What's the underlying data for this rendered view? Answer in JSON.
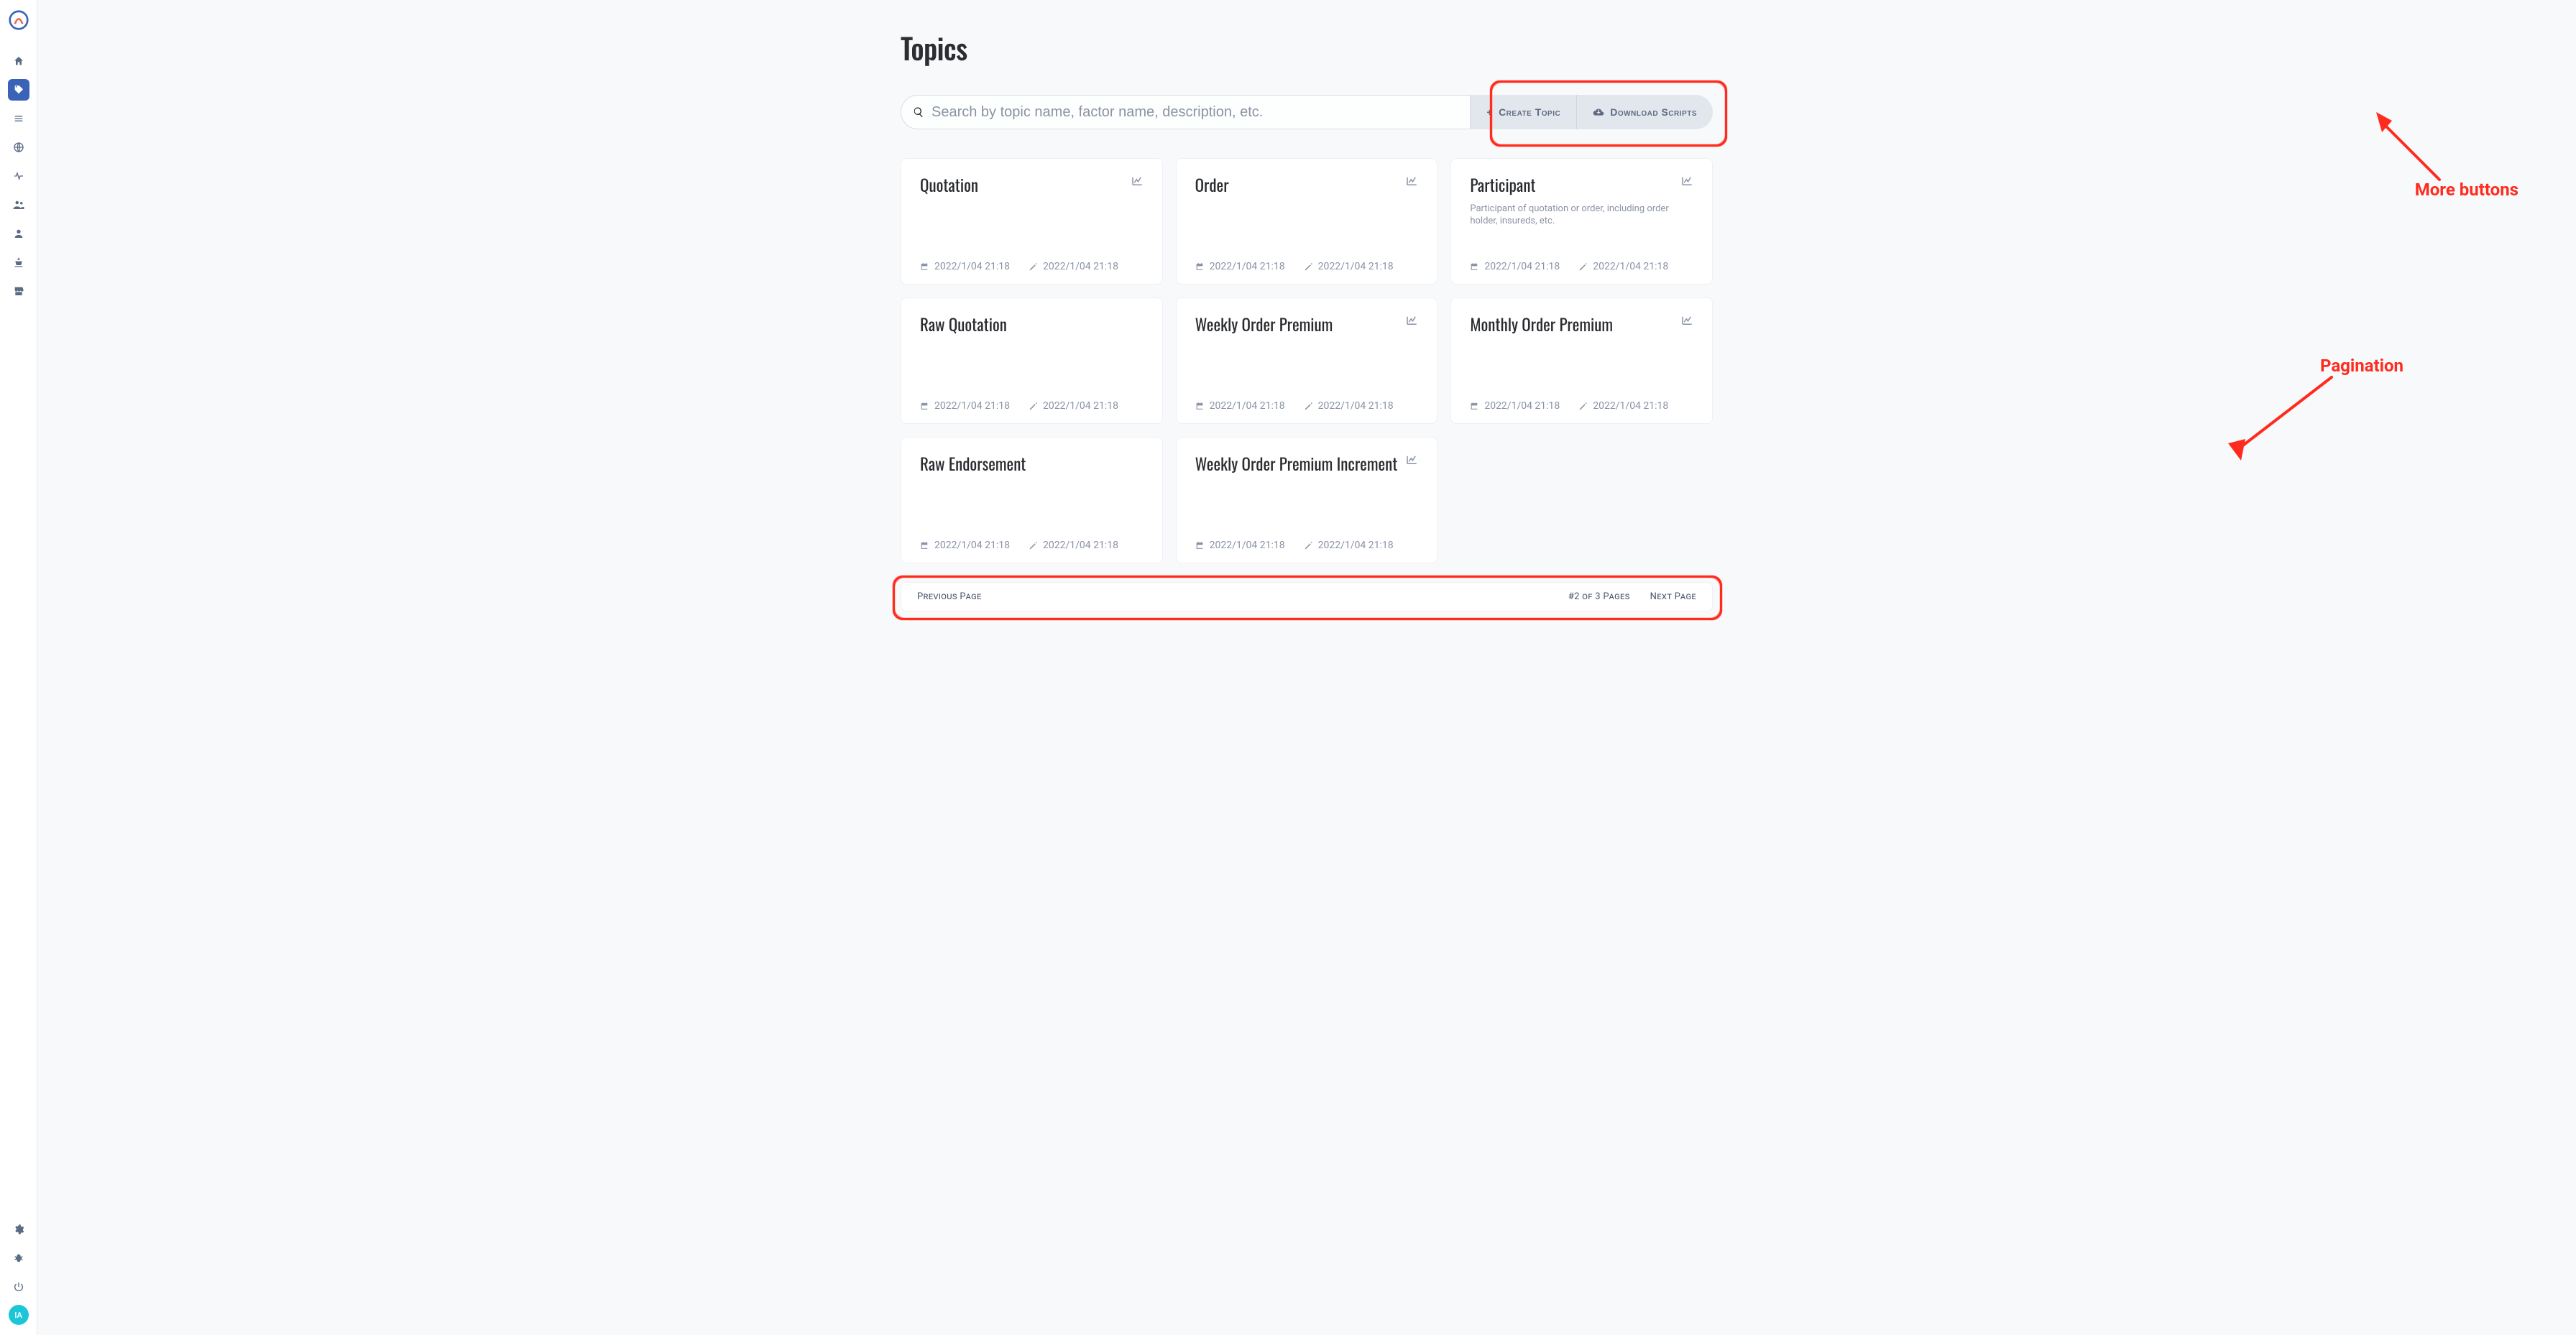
{
  "sidebar": {
    "avatar_initials": "IA"
  },
  "page": {
    "title": "Topics"
  },
  "toolbar": {
    "search_placeholder": "Search by topic name, factor name, description, etc.",
    "create_label": "Create Topic",
    "download_label": "Download Scripts"
  },
  "cards": [
    {
      "title": "Quotation",
      "desc": "",
      "hasChart": true,
      "created": "2022/1/04 21:18",
      "modified": "2022/1/04 21:18"
    },
    {
      "title": "Order",
      "desc": "",
      "hasChart": true,
      "created": "2022/1/04 21:18",
      "modified": "2022/1/04 21:18"
    },
    {
      "title": "Participant",
      "desc": "Participant of quotation or order, including order holder, insureds, etc.",
      "hasChart": true,
      "created": "2022/1/04 21:18",
      "modified": "2022/1/04 21:18"
    },
    {
      "title": "Raw Quotation",
      "desc": "",
      "hasChart": false,
      "created": "2022/1/04 21:18",
      "modified": "2022/1/04 21:18"
    },
    {
      "title": "Weekly Order Premium",
      "desc": "",
      "hasChart": true,
      "created": "2022/1/04 21:18",
      "modified": "2022/1/04 21:18"
    },
    {
      "title": "Monthly Order Premium",
      "desc": "",
      "hasChart": true,
      "created": "2022/1/04 21:18",
      "modified": "2022/1/04 21:18"
    },
    {
      "title": "Raw Endorsement",
      "desc": "",
      "hasChart": false,
      "created": "2022/1/04 21:18",
      "modified": "2022/1/04 21:18"
    },
    {
      "title": "Weekly Order Premium Increment",
      "desc": "",
      "hasChart": true,
      "created": "2022/1/04 21:18",
      "modified": "2022/1/04 21:18"
    }
  ],
  "pagination": {
    "prev": "Previous Page",
    "summary": "#2 of 3 Pages",
    "next": "Next Page"
  },
  "annotations": {
    "more_buttons": "More buttons",
    "pagination": "Pagination"
  }
}
